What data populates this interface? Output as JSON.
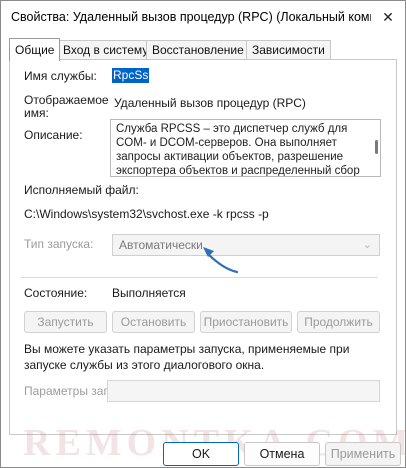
{
  "window": {
    "title": "Свойства: Удаленный вызов процедур (RPC) (Локальный компь",
    "close_glyph": "✕"
  },
  "tabs": [
    {
      "label": "Общие",
      "active": true
    },
    {
      "label": "Вход в систему",
      "active": false
    },
    {
      "label": "Восстановление",
      "active": false
    },
    {
      "label": "Зависимости",
      "active": false
    }
  ],
  "general": {
    "service_name_label": "Имя службы:",
    "service_name_value": "RpcSs",
    "display_name_label_line1": "Отображаемое",
    "display_name_label_line2": "имя:",
    "display_name_value": "Удаленный вызов процедур (RPC)",
    "description_label": "Описание:",
    "description_text": "Служба RPCSS – это диспетчер служб для COM- и DCOM-серверов. Она выполняет запросы активации объектов, разрешение экспортера объектов и распределенный сбор мусора для",
    "exe_label": "Исполняемый файл:",
    "exe_path": "C:\\Windows\\system32\\svchost.exe -k rpcss -p",
    "startup_type_label": "Тип запуска:",
    "startup_type_value": "Автоматически",
    "status_label": "Состояние:",
    "status_value": "Выполняется",
    "buttons": {
      "start": "Запустить",
      "stop": "Остановить",
      "pause": "Приостановить",
      "resume": "Продолжить"
    },
    "hint_text": "Вы можете указать параметры запуска, применяемые при запуске службы из этого диалогового окна.",
    "params_label": "Параметры запуска:",
    "params_value": ""
  },
  "footer": {
    "ok": "OK",
    "cancel": "Отмена",
    "apply": "Применить"
  },
  "watermark": "REMONTKA.COM",
  "colors": {
    "selection": "#0063c9",
    "annotation_arrow": "#2f6fb5",
    "primary_border": "#0067c0"
  },
  "icons": {
    "close": "close-icon",
    "dropdown": "chevron-down-icon",
    "annotation": "curved-arrow-icon"
  }
}
